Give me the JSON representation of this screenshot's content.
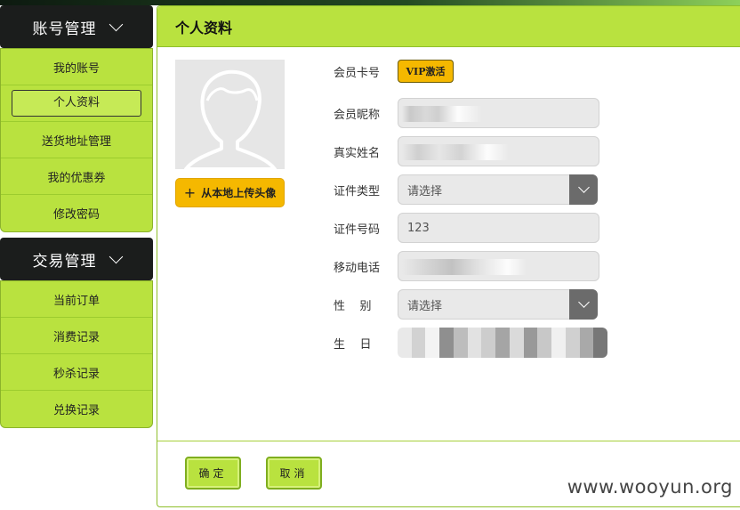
{
  "sidebar": {
    "groups": [
      {
        "title": "账号管理",
        "items": [
          "我的账号",
          "个人资料",
          "送货地址管理",
          "我的优惠券",
          "修改密码"
        ],
        "active_index": 1
      },
      {
        "title": "交易管理",
        "items": [
          "当前订单",
          "消费记录",
          "秒杀记录",
          "兑换记录"
        ]
      }
    ]
  },
  "main": {
    "title": "个人资料",
    "upload_label": "从本地上传头像",
    "form": {
      "card_label": "会员卡号",
      "vip_label": "VIP激活",
      "nickname_label": "会员昵称",
      "realname_label": "真实姓名",
      "idtype_label": "证件类型",
      "idtype_value": "请选择",
      "idnum_label": "证件号码",
      "idnum_value": "123",
      "phone_label": "移动电话",
      "gender_label": "性    别",
      "gender_value": "请选择",
      "birthday_label": "生    日"
    },
    "confirm_label": "确定",
    "cancel_label": "取消"
  },
  "watermark": "www.wooyun.org",
  "colors": {
    "accent_green": "#b9e23f",
    "header_dark": "#1b1d1c",
    "button_orange": "#f5b800",
    "select_gray": "#6b6b6b"
  }
}
